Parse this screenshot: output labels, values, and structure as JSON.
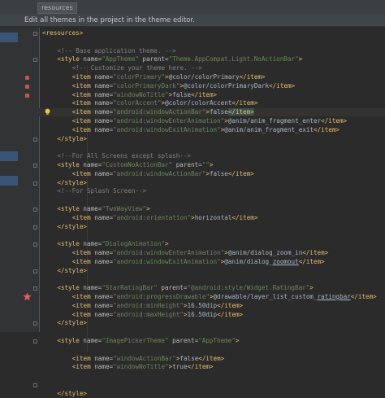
{
  "tab": {
    "label": "resources"
  },
  "banner": {
    "text": "Edit all themes in the project in the theme editor."
  },
  "colors": {
    "bg": "#2b2b2b",
    "tag": "#e8bf6a",
    "attr": "#bababa",
    "value": "#6a8759",
    "comment": "#808080",
    "text": "#a9b7c6"
  },
  "code_lines": [
    {
      "indent": 0,
      "segments": [
        {
          "k": "tag",
          "t": "<resources>"
        }
      ]
    },
    {
      "indent": 0,
      "segments": []
    },
    {
      "indent": 2,
      "segments": [
        {
          "k": "cmt",
          "t": "<!-- Base application theme. -->"
        }
      ]
    },
    {
      "indent": 2,
      "segments": [
        {
          "k": "tag",
          "t": "<style "
        },
        {
          "k": "attr",
          "t": "name="
        },
        {
          "k": "val",
          "t": "\"AppTheme\""
        },
        {
          "k": "attr",
          "t": " parent="
        },
        {
          "k": "val",
          "t": "\"Theme.AppCompat.Light.NoActionBar\""
        },
        {
          "k": "tag",
          "t": ">"
        }
      ]
    },
    {
      "indent": 4,
      "segments": [
        {
          "k": "cmt",
          "t": "<!-- Customize your theme here. -->"
        }
      ]
    },
    {
      "indent": 4,
      "segments": [
        {
          "k": "tag",
          "t": "<item "
        },
        {
          "k": "attr",
          "t": "name="
        },
        {
          "k": "val",
          "t": "\"colorPrimary\""
        },
        {
          "k": "tag",
          "t": ">"
        },
        {
          "k": "txt",
          "t": "@color/colorPrimary"
        },
        {
          "k": "tag",
          "t": "</item>"
        }
      ]
    },
    {
      "indent": 4,
      "segments": [
        {
          "k": "tag",
          "t": "<item "
        },
        {
          "k": "attr",
          "t": "name="
        },
        {
          "k": "val",
          "t": "\"colorPrimaryDark\""
        },
        {
          "k": "tag",
          "t": ">"
        },
        {
          "k": "txt",
          "t": "@color/colorPrimaryDark"
        },
        {
          "k": "tag",
          "t": "</item>"
        }
      ]
    },
    {
      "indent": 4,
      "segments": [
        {
          "k": "tag",
          "t": "<item "
        },
        {
          "k": "attr",
          "t": "name="
        },
        {
          "k": "val",
          "t": "\"windowNoTitle\""
        },
        {
          "k": "tag",
          "t": ">"
        },
        {
          "k": "txt",
          "t": "false"
        },
        {
          "k": "tag",
          "t": "</item>"
        }
      ]
    },
    {
      "indent": 4,
      "segments": [
        {
          "k": "tag",
          "t": "<item "
        },
        {
          "k": "attr",
          "t": "name="
        },
        {
          "k": "val",
          "t": "\"colorAccent\""
        },
        {
          "k": "tag",
          "t": ">"
        },
        {
          "k": "txt",
          "t": "@color/colorAccent"
        },
        {
          "k": "tag",
          "t": "</item>"
        }
      ]
    },
    {
      "indent": 4,
      "hl": true,
      "segments": [
        {
          "k": "tag",
          "t": "<item "
        },
        {
          "k": "attr",
          "t": "name="
        },
        {
          "k": "val",
          "t": "\"android:windowActionBar\""
        },
        {
          "k": "tag",
          "t": ">"
        },
        {
          "k": "txt",
          "t": "false"
        },
        {
          "k": "tag",
          "t": "</item>"
        }
      ]
    },
    {
      "indent": 4,
      "segments": [
        {
          "k": "tag",
          "t": "<item "
        },
        {
          "k": "attr",
          "t": "name="
        },
        {
          "k": "val",
          "t": "\"android:windowEnterAnimation\""
        },
        {
          "k": "tag",
          "t": ">"
        },
        {
          "k": "txt",
          "t": "@anim/anim_fragment_enter"
        },
        {
          "k": "tag",
          "t": "</item>"
        }
      ]
    },
    {
      "indent": 4,
      "segments": [
        {
          "k": "tag",
          "t": "<item "
        },
        {
          "k": "attr",
          "t": "name="
        },
        {
          "k": "val",
          "t": "\"android:windowExitAnimation\""
        },
        {
          "k": "tag",
          "t": ">"
        },
        {
          "k": "txt",
          "t": "@anim/anim_fragment_exit"
        },
        {
          "k": "tag",
          "t": "</item>"
        }
      ]
    },
    {
      "indent": 2,
      "segments": [
        {
          "k": "tag",
          "t": "</style>"
        }
      ]
    },
    {
      "indent": 0,
      "segments": []
    },
    {
      "indent": 2,
      "segments": [
        {
          "k": "cmt",
          "t": "<!--For All Screens except splash-->"
        }
      ]
    },
    {
      "indent": 2,
      "segments": [
        {
          "k": "tag",
          "t": "<style "
        },
        {
          "k": "attr",
          "t": "name="
        },
        {
          "k": "val",
          "t": "\"CustomNoActionBar\""
        },
        {
          "k": "attr",
          "t": " parent="
        },
        {
          "k": "val",
          "t": "\"\""
        },
        {
          "k": "tag",
          "t": ">"
        }
      ]
    },
    {
      "indent": 4,
      "segments": [
        {
          "k": "tag",
          "t": "<item "
        },
        {
          "k": "attr",
          "t": "name="
        },
        {
          "k": "val",
          "t": "\"android:windowActionBar\""
        },
        {
          "k": "tag",
          "t": ">"
        },
        {
          "k": "txt",
          "t": "false"
        },
        {
          "k": "tag",
          "t": "</item>"
        }
      ]
    },
    {
      "indent": 2,
      "segments": [
        {
          "k": "tag",
          "t": "</style>"
        }
      ]
    },
    {
      "indent": 2,
      "segments": [
        {
          "k": "cmt",
          "t": "<!--For Splash Screen-->"
        }
      ]
    },
    {
      "indent": 0,
      "segments": []
    },
    {
      "indent": 2,
      "segments": [
        {
          "k": "tag",
          "t": "<style "
        },
        {
          "k": "attr",
          "t": "name="
        },
        {
          "k": "val",
          "t": "\"TwoWayView\""
        },
        {
          "k": "tag",
          "t": ">"
        }
      ]
    },
    {
      "indent": 4,
      "segments": [
        {
          "k": "tag",
          "t": "<item "
        },
        {
          "k": "attr",
          "t": "name="
        },
        {
          "k": "val",
          "t": "\"android:orientation\""
        },
        {
          "k": "tag",
          "t": ">"
        },
        {
          "k": "txt",
          "t": "horizontal"
        },
        {
          "k": "tag",
          "t": "</item>"
        }
      ]
    },
    {
      "indent": 2,
      "segments": [
        {
          "k": "tag",
          "t": "</style>"
        }
      ]
    },
    {
      "indent": 0,
      "segments": []
    },
    {
      "indent": 2,
      "segments": [
        {
          "k": "tag",
          "t": "<style "
        },
        {
          "k": "attr",
          "t": "name="
        },
        {
          "k": "val",
          "t": "\"DialogAnimation\""
        },
        {
          "k": "tag",
          "t": ">"
        }
      ]
    },
    {
      "indent": 4,
      "segments": [
        {
          "k": "tag",
          "t": "<item "
        },
        {
          "k": "attr",
          "t": "name="
        },
        {
          "k": "val",
          "t": "\"android:windowEnterAnimation\""
        },
        {
          "k": "tag",
          "t": ">"
        },
        {
          "k": "txt",
          "t": "@anim/dialog_zoom_in"
        },
        {
          "k": "tag",
          "t": "</item>"
        }
      ]
    },
    {
      "indent": 4,
      "segments": [
        {
          "k": "tag",
          "t": "<item "
        },
        {
          "k": "attr",
          "t": "name="
        },
        {
          "k": "val",
          "t": "\"android:windowExitAnimation\""
        },
        {
          "k": "tag",
          "t": ">"
        },
        {
          "k": "txt",
          "t": "@anim/dialog_"
        },
        {
          "k": "dash",
          "t": "zoomout"
        },
        {
          "k": "tag",
          "t": "</item>"
        }
      ]
    },
    {
      "indent": 2,
      "segments": [
        {
          "k": "tag",
          "t": "</style>"
        }
      ]
    },
    {
      "indent": 0,
      "segments": []
    },
    {
      "indent": 2,
      "segments": [
        {
          "k": "tag",
          "t": "<style "
        },
        {
          "k": "attr",
          "t": "name="
        },
        {
          "k": "val",
          "t": "\"StarRatingBar\""
        },
        {
          "k": "attr",
          "t": " parent="
        },
        {
          "k": "val",
          "t": "\"@android:style/Widget.RatingBar\""
        },
        {
          "k": "tag",
          "t": ">"
        }
      ]
    },
    {
      "indent": 4,
      "segments": [
        {
          "k": "tag",
          "t": "<item "
        },
        {
          "k": "attr",
          "t": "name="
        },
        {
          "k": "val",
          "t": "\"android:progressDrawable\""
        },
        {
          "k": "tag",
          "t": ">"
        },
        {
          "k": "txt",
          "t": "@drawable/layer_list_custom_"
        },
        {
          "k": "dash",
          "t": "ratingbar"
        },
        {
          "k": "tag",
          "t": "</item>"
        }
      ]
    },
    {
      "indent": 4,
      "segments": [
        {
          "k": "tag",
          "t": "<item "
        },
        {
          "k": "attr",
          "t": "name="
        },
        {
          "k": "val",
          "t": "\"android:minHeight\""
        },
        {
          "k": "tag",
          "t": ">"
        },
        {
          "k": "txt",
          "t": "16.50dip"
        },
        {
          "k": "tag",
          "t": "</item>"
        }
      ]
    },
    {
      "indent": 4,
      "segments": [
        {
          "k": "tag",
          "t": "<item "
        },
        {
          "k": "attr",
          "t": "name="
        },
        {
          "k": "val",
          "t": "\"android:maxHeight\""
        },
        {
          "k": "tag",
          "t": ">"
        },
        {
          "k": "txt",
          "t": "16.50dip"
        },
        {
          "k": "tag",
          "t": "</item>"
        }
      ]
    },
    {
      "indent": 2,
      "segments": [
        {
          "k": "tag",
          "t": "</style>"
        }
      ]
    },
    {
      "indent": 0,
      "segments": []
    },
    {
      "indent": 2,
      "segments": [
        {
          "k": "tag",
          "t": "<style "
        },
        {
          "k": "attr",
          "t": "name="
        },
        {
          "k": "val",
          "t": "\"ImagePickerTheme\""
        },
        {
          "k": "attr",
          "t": " parent="
        },
        {
          "k": "val",
          "t": "\"AppTheme\""
        },
        {
          "k": "tag",
          "t": ">"
        }
      ]
    },
    {
      "indent": 0,
      "segments": []
    },
    {
      "indent": 4,
      "segments": [
        {
          "k": "tag",
          "t": "<item "
        },
        {
          "k": "attr",
          "t": "name="
        },
        {
          "k": "val",
          "t": "\"windowActionBar\""
        },
        {
          "k": "tag",
          "t": ">"
        },
        {
          "k": "txt",
          "t": "false"
        },
        {
          "k": "tag",
          "t": "</item>"
        }
      ]
    },
    {
      "indent": 4,
      "segments": [
        {
          "k": "tag",
          "t": "<item "
        },
        {
          "k": "attr",
          "t": "name="
        },
        {
          "k": "val",
          "t": "\"windowNoTitle\""
        },
        {
          "k": "tag",
          "t": ">"
        },
        {
          "k": "txt",
          "t": "true"
        },
        {
          "k": "tag",
          "t": "</item>"
        }
      ]
    },
    {
      "indent": 0,
      "segments": []
    },
    {
      "indent": 0,
      "segments": []
    },
    {
      "indent": 2,
      "segments": [
        {
          "k": "tag",
          "t": "</style>"
        }
      ]
    }
  ],
  "gutter_markers": {
    "breakpoints": [
      5,
      6,
      7
    ],
    "bulb": [
      9
    ],
    "star": [
      30
    ],
    "folds": [
      0,
      3,
      12,
      15,
      17,
      20,
      22,
      24,
      27,
      29,
      33,
      35,
      40
    ]
  }
}
